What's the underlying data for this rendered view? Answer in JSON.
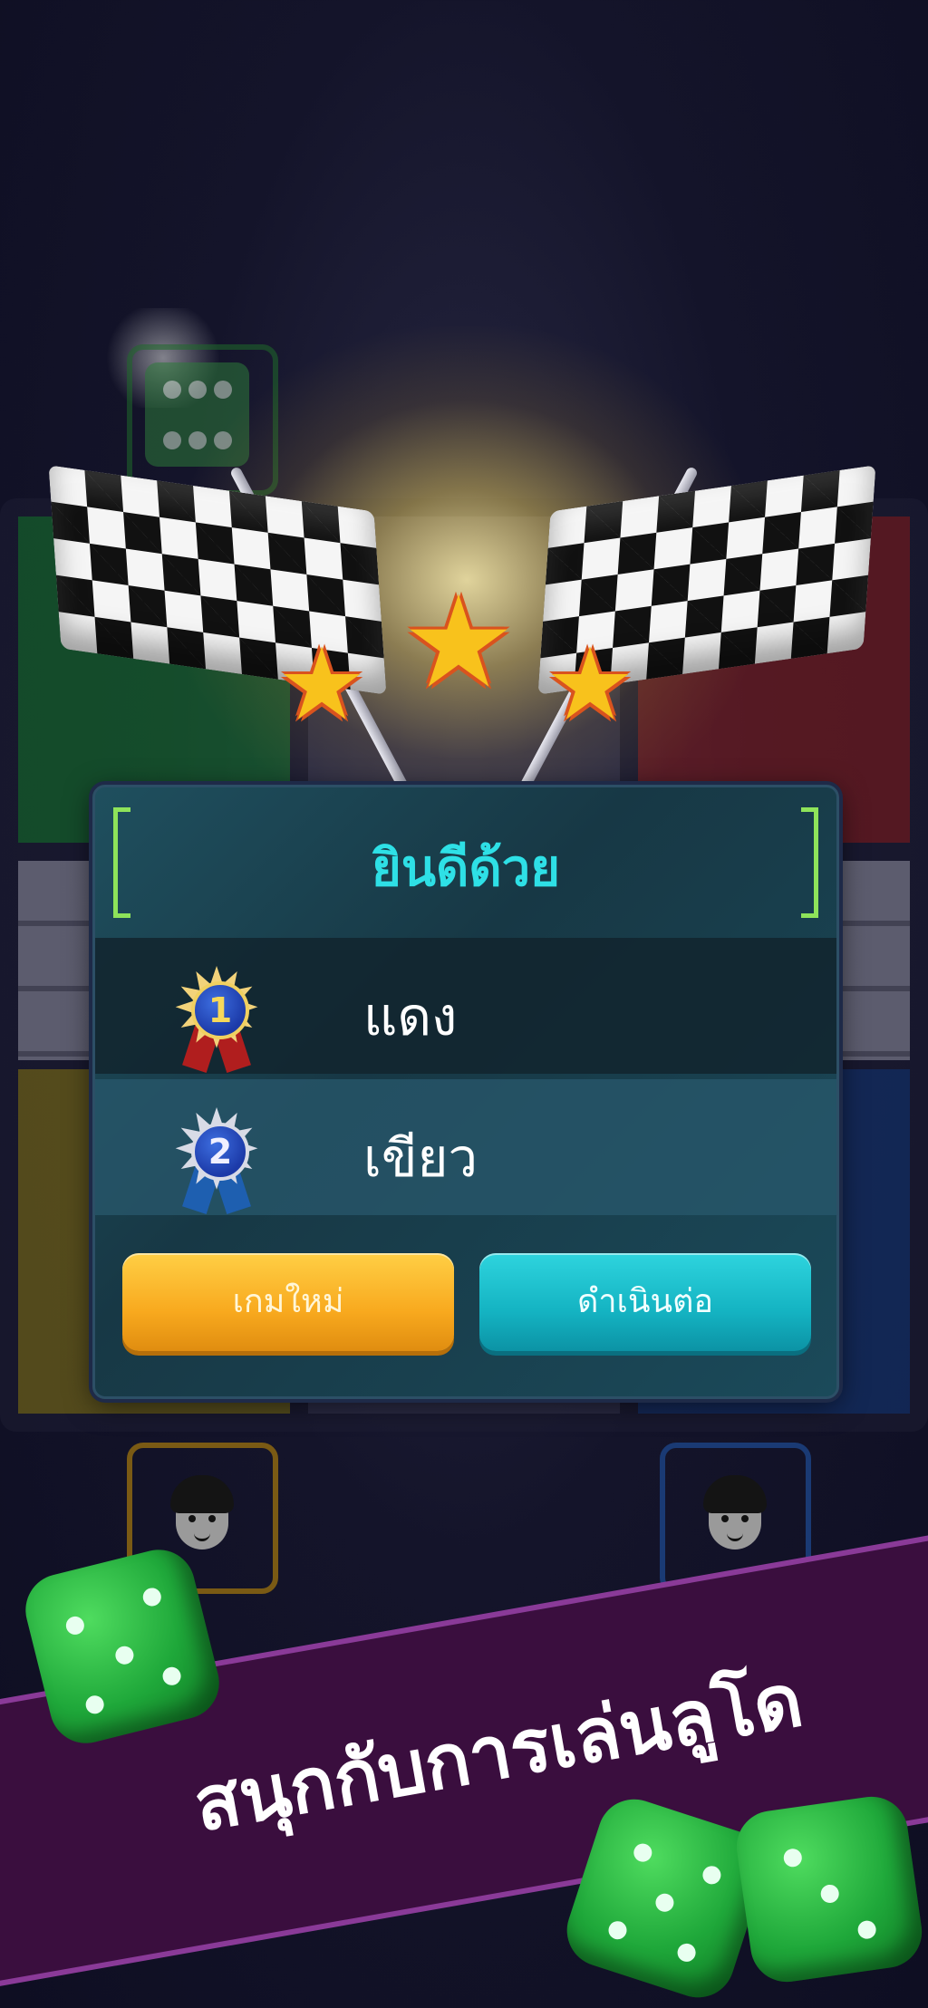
{
  "dialog": {
    "title": "ยินดีด้วย",
    "rankings": [
      {
        "rank": "1",
        "name": "แดง"
      },
      {
        "rank": "2",
        "name": "เขียว"
      }
    ],
    "buttons": {
      "new_game": "เกมใหม่",
      "continue": "ดำเนินต่อ"
    }
  },
  "banner": {
    "text": "สนุกกับการเล่นลูโด"
  },
  "stars": {
    "glyph": "★",
    "earned": 3,
    "total": 3
  },
  "colors": {
    "title": "#2ee0e6",
    "new_game_button": "#f8a91e",
    "continue_button": "#14b3c2",
    "banner": "#3a0e3e",
    "bracket": "#8ee35a"
  }
}
